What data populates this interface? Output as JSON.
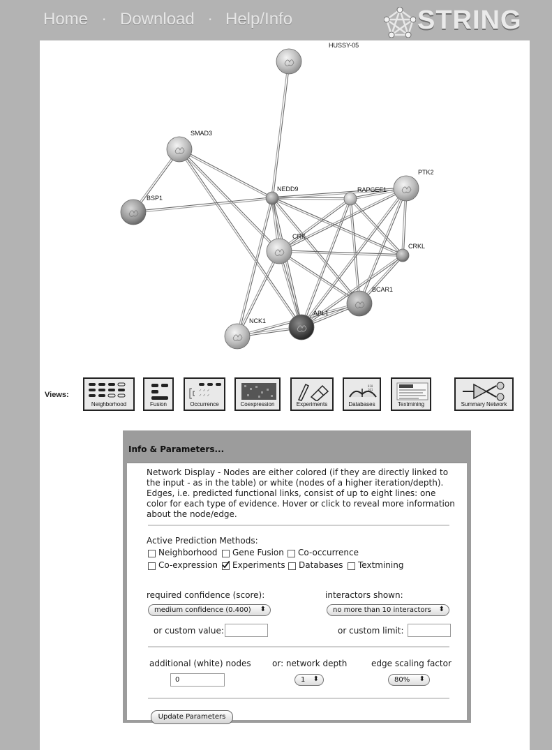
{
  "nav": {
    "home": "Home",
    "download": "Download",
    "help": "Help/Info",
    "separator": "·",
    "logo_text": "STRING"
  },
  "network": {
    "nodes": [
      {
        "id": "HUSSY-05",
        "label": "HUSSY-05",
        "size": "large",
        "shade": "light"
      },
      {
        "id": "SMAD3",
        "label": "SMAD3",
        "size": "large",
        "shade": "light"
      },
      {
        "id": "BSP1",
        "label": "BSP1",
        "size": "large",
        "shade": "medium"
      },
      {
        "id": "NEDD9",
        "label": "NEDD9",
        "size": "small",
        "shade": "medium"
      },
      {
        "id": "RAPGEF1",
        "label": "RAPGEF1",
        "size": "small",
        "shade": "light"
      },
      {
        "id": "PTK2",
        "label": "PTK2",
        "size": "large",
        "shade": "light"
      },
      {
        "id": "CRK",
        "label": "CRK",
        "size": "large",
        "shade": "light"
      },
      {
        "id": "CRKL",
        "label": "CRKL",
        "size": "small",
        "shade": "medium"
      },
      {
        "id": "BCAR1",
        "label": "BCAR1",
        "size": "large",
        "shade": "medium"
      },
      {
        "id": "ABL1",
        "label": "ABL1",
        "size": "large",
        "shade": "dark"
      },
      {
        "id": "NCK1",
        "label": "NCK1",
        "size": "large",
        "shade": "light"
      }
    ],
    "edges": [
      [
        "HUSSY-05",
        "NEDD9"
      ],
      [
        "SMAD3",
        "BSP1"
      ],
      [
        "SMAD3",
        "NEDD9"
      ],
      [
        "SMAD3",
        "CRK"
      ],
      [
        "SMAD3",
        "ABL1"
      ],
      [
        "BSP1",
        "NEDD9"
      ],
      [
        "NEDD9",
        "RAPGEF1"
      ],
      [
        "NEDD9",
        "CRK"
      ],
      [
        "NEDD9",
        "CRKL"
      ],
      [
        "NEDD9",
        "BCAR1"
      ],
      [
        "NEDD9",
        "ABL1"
      ],
      [
        "NEDD9",
        "NCK1"
      ],
      [
        "NEDD9",
        "PTK2"
      ],
      [
        "RAPGEF1",
        "PTK2"
      ],
      [
        "RAPGEF1",
        "CRK"
      ],
      [
        "RAPGEF1",
        "CRKL"
      ],
      [
        "RAPGEF1",
        "BCAR1"
      ],
      [
        "RAPGEF1",
        "ABL1"
      ],
      [
        "PTK2",
        "CRK"
      ],
      [
        "PTK2",
        "CRKL"
      ],
      [
        "PTK2",
        "BCAR1"
      ],
      [
        "PTK2",
        "ABL1"
      ],
      [
        "CRK",
        "CRKL"
      ],
      [
        "CRK",
        "BCAR1"
      ],
      [
        "CRK",
        "ABL1"
      ],
      [
        "CRK",
        "NCK1"
      ],
      [
        "CRKL",
        "BCAR1"
      ],
      [
        "CRKL",
        "ABL1"
      ],
      [
        "BCAR1",
        "ABL1"
      ],
      [
        "BCAR1",
        "NCK1"
      ],
      [
        "ABL1",
        "NCK1"
      ]
    ]
  },
  "views": {
    "label": "Views:",
    "buttons": [
      {
        "id": "neighborhood",
        "label": "Neighborhood",
        "icon": "neighborhood-icon"
      },
      {
        "id": "fusion",
        "label": "Fusion",
        "icon": "fusion-icon"
      },
      {
        "id": "occurrence",
        "label": "Occurrence",
        "icon": "occurrence-icon"
      },
      {
        "id": "coexpression",
        "label": "Coexpression",
        "icon": "coexpression-icon"
      },
      {
        "id": "experiments",
        "label": "Experiments",
        "icon": "experiments-icon"
      },
      {
        "id": "databases",
        "label": "Databases",
        "icon": "databases-icon"
      },
      {
        "id": "textmining",
        "label": "Textmining",
        "icon": "textmining-icon"
      },
      {
        "id": "summary",
        "label": "Summary Network",
        "icon": "summary-network-icon"
      }
    ]
  },
  "panel": {
    "title": "Info & Parameters...",
    "description": [
      "Network Display - Nodes are either colored (if they are directly linked to",
      "the input - as in the table) or white (nodes of a higher iteration/depth).",
      "Edges, i.e. predicted functional links, consist of up to eight lines: one",
      "color for each type of evidence. Hover or click to reveal more information",
      "about the node/edge."
    ],
    "methods_label": "Active Prediction Methods:",
    "methods": [
      {
        "label": "Neighborhood",
        "checked": false
      },
      {
        "label": "Gene Fusion",
        "checked": false
      },
      {
        "label": "Co-occurrence",
        "checked": false
      },
      {
        "label": "Co-expression",
        "checked": false
      },
      {
        "label": "Experiments",
        "checked": true
      },
      {
        "label": "Databases",
        "checked": false
      },
      {
        "label": "Textmining",
        "checked": false
      }
    ],
    "confidence_label": "required confidence (score):",
    "confidence_value": "medium confidence (0.400)",
    "interactors_label": "interactors shown:",
    "interactors_value": "no more than 10 interactors",
    "custom_value_label": "or custom value:",
    "custom_value": "",
    "custom_limit_label": "or custom limit:",
    "custom_limit": "",
    "additional_label": "additional (white) nodes",
    "additional_value": "0",
    "depth_label": "or: network depth",
    "depth_value": "1",
    "scaling_label": "edge scaling factor",
    "scaling_value": "80%",
    "update_label": "Update Parameters",
    "select_arrow": "⬍"
  }
}
